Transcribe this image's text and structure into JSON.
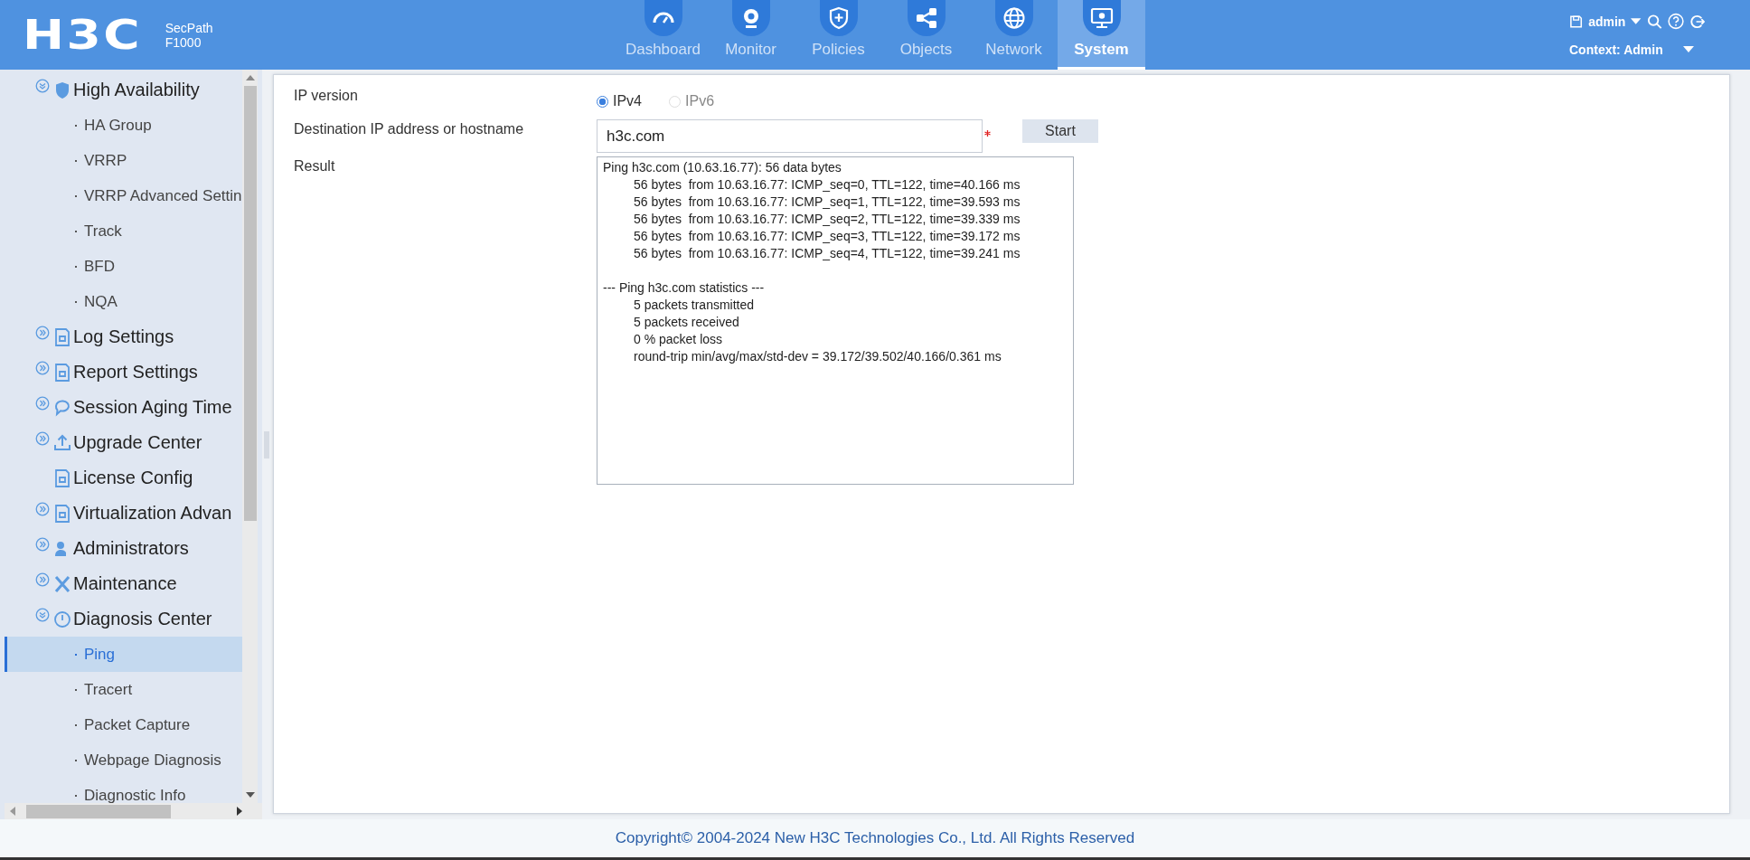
{
  "header": {
    "logo": "H3C",
    "product": [
      "SecPath",
      "F1000"
    ],
    "user": "admin",
    "context": "Context: Admin"
  },
  "nav": [
    {
      "label": "Dashboard",
      "selected": false
    },
    {
      "label": "Monitor",
      "selected": false
    },
    {
      "label": "Policies",
      "selected": false
    },
    {
      "label": "Objects",
      "selected": false
    },
    {
      "label": "Network",
      "selected": false
    },
    {
      "label": "System",
      "selected": true
    }
  ],
  "sidebar": {
    "items": [
      {
        "label": "High Availability",
        "kind": "group",
        "expanded": true,
        "children": [
          {
            "label": "HA Group",
            "selected": false
          },
          {
            "label": "VRRP",
            "selected": false
          },
          {
            "label": "VRRP Advanced Settin",
            "selected": false
          },
          {
            "label": "Track",
            "selected": false
          },
          {
            "label": "BFD",
            "selected": false
          },
          {
            "label": "NQA",
            "selected": false
          }
        ]
      },
      {
        "label": "Log Settings",
        "kind": "group",
        "expanded": false
      },
      {
        "label": "Report Settings",
        "kind": "group",
        "expanded": false
      },
      {
        "label": "Session Aging Time",
        "kind": "group",
        "expanded": false
      },
      {
        "label": "Upgrade Center",
        "kind": "group",
        "expanded": false
      },
      {
        "label": "License Config",
        "kind": "page"
      },
      {
        "label": "Virtualization Advan",
        "kind": "group",
        "expanded": false
      },
      {
        "label": "Administrators",
        "kind": "group",
        "expanded": false
      },
      {
        "label": "Maintenance",
        "kind": "group",
        "expanded": false
      },
      {
        "label": "Diagnosis Center",
        "kind": "group",
        "expanded": true,
        "children": [
          {
            "label": "Ping",
            "selected": true
          },
          {
            "label": "Tracert",
            "selected": false
          },
          {
            "label": "Packet Capture",
            "selected": false
          },
          {
            "label": "Webpage Diagnosis",
            "selected": false
          },
          {
            "label": "Diagnostic Info",
            "selected": false
          }
        ]
      }
    ]
  },
  "form": {
    "ip_version": {
      "label": "IP version",
      "options": [
        {
          "label": "IPv4",
          "selected": true
        },
        {
          "label": "IPv6",
          "selected": false
        }
      ]
    },
    "destination": {
      "label": "Destination IP address or hostname",
      "value": "h3c.com",
      "required": true
    },
    "start_button": "Start",
    "result": {
      "label": "Result",
      "blocks": [
        {
          "heading": "Ping h3c.com (10.63.16.77): 56 data bytes",
          "lines": [
            "56 bytes  from 10.63.16.77: ICMP_seq=0, TTL=122, time=40.166 ms",
            "56 bytes  from 10.63.16.77: ICMP_seq=1, TTL=122, time=39.593 ms",
            "56 bytes  from 10.63.16.77: ICMP_seq=2, TTL=122, time=39.339 ms",
            "56 bytes  from 10.63.16.77: ICMP_seq=3, TTL=122, time=39.172 ms",
            "56 bytes  from 10.63.16.77: ICMP_seq=4, TTL=122, time=39.241 ms"
          ]
        },
        {
          "heading": "--- Ping h3c.com statistics ---",
          "lines": [
            "5 packets transmitted",
            "5 packets received",
            "0 % packet loss",
            "round-trip min/avg/max/std-dev = 39.172/39.502/40.166/0.361 ms"
          ]
        }
      ]
    }
  },
  "footer": "Copyright© 2004-2024 New H3C Technologies Co., Ltd. All Rights Reserved"
}
